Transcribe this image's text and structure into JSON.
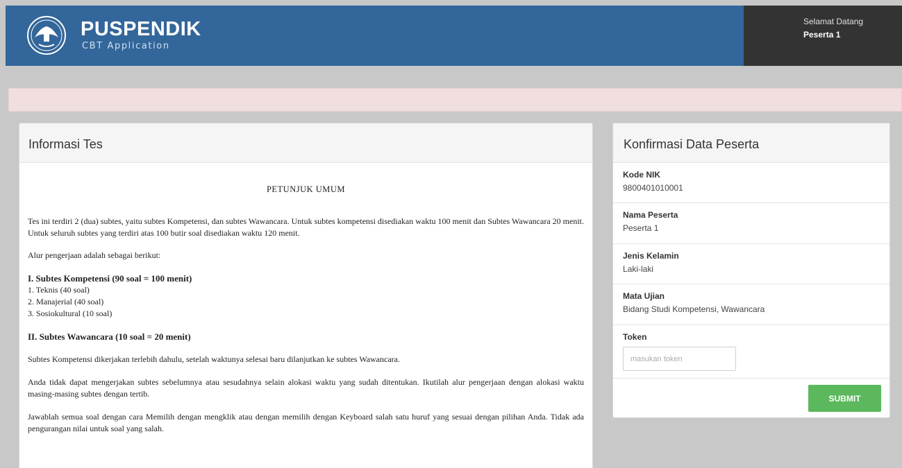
{
  "header": {
    "brand_title": "PUSPENDIK",
    "brand_subtitle": "CBT Application",
    "logo_icon": "garuda-emblem-icon",
    "greeting": "Selamat Datang",
    "username": "Peserta 1"
  },
  "info_panel": {
    "title": "Informasi Tes",
    "doc_title": "PETUNJUK UMUM",
    "intro": "Tes ini terdiri 2 (dua) subtes, yaitu subtes Kompetensi, dan subtes Wawancara. Untuk subtes kompetensi disediakan waktu 100 menit dan Subtes Wawancara 20 menit. Untuk seluruh subtes yang terdiri atas 100 butir soal disediakan waktu 120 menit.",
    "flow_intro": "Alur pengerjaan adalah sebagai berikut:",
    "section1_title": "I. Subtes Kompetensi (90 soal = 100 menit)",
    "section1_items": [
      "1. Teknis (40 soal)",
      "2. Manajerial (40 soal)",
      "3. Sosiokultural (10 soal)"
    ],
    "section2_title": "II. Subtes Wawancara (10 soal = 20 menit)",
    "para1": "Subtes Kompetensi dikerjakan terlebih dahulu, setelah waktunya selesai baru dilanjutkan ke subtes Wawancara.",
    "para2": "Anda tidak dapat mengerjakan subtes sebelumnya atau sesudahnya selain alokasi waktu yang sudah ditentukan. Ikutilah alur pengerjaan dengan alokasi waktu masing-masing subtes dengan tertib.",
    "para3": "Jawablah semua soal dengan cara Memilih dengan mengklik atau dengan memilih dengan Keyboard salah satu huruf yang sesuai dengan pilihan Anda. Tidak ada pengurangan nilai untuk soal yang salah."
  },
  "confirm_panel": {
    "title": "Konfirmasi Data Peserta",
    "fields": [
      {
        "label": "Kode NIK",
        "value": "9800401010001"
      },
      {
        "label": "Nama Peserta",
        "value": "Peserta 1"
      },
      {
        "label": "Jenis Kelamin",
        "value": "Laki-laki"
      },
      {
        "label": "Mata Ujian",
        "value": "Bidang Studi Kompetensi, Wawancara"
      }
    ],
    "token_label": "Token",
    "token_placeholder": "masukan token",
    "submit_label": "SUBMIT"
  },
  "colors": {
    "header_bg": "#33669a",
    "user_box_bg": "#333333",
    "alert_bg": "#f1dede",
    "submit_bg": "#5cb85c",
    "page_bg": "#c8c8c8"
  }
}
